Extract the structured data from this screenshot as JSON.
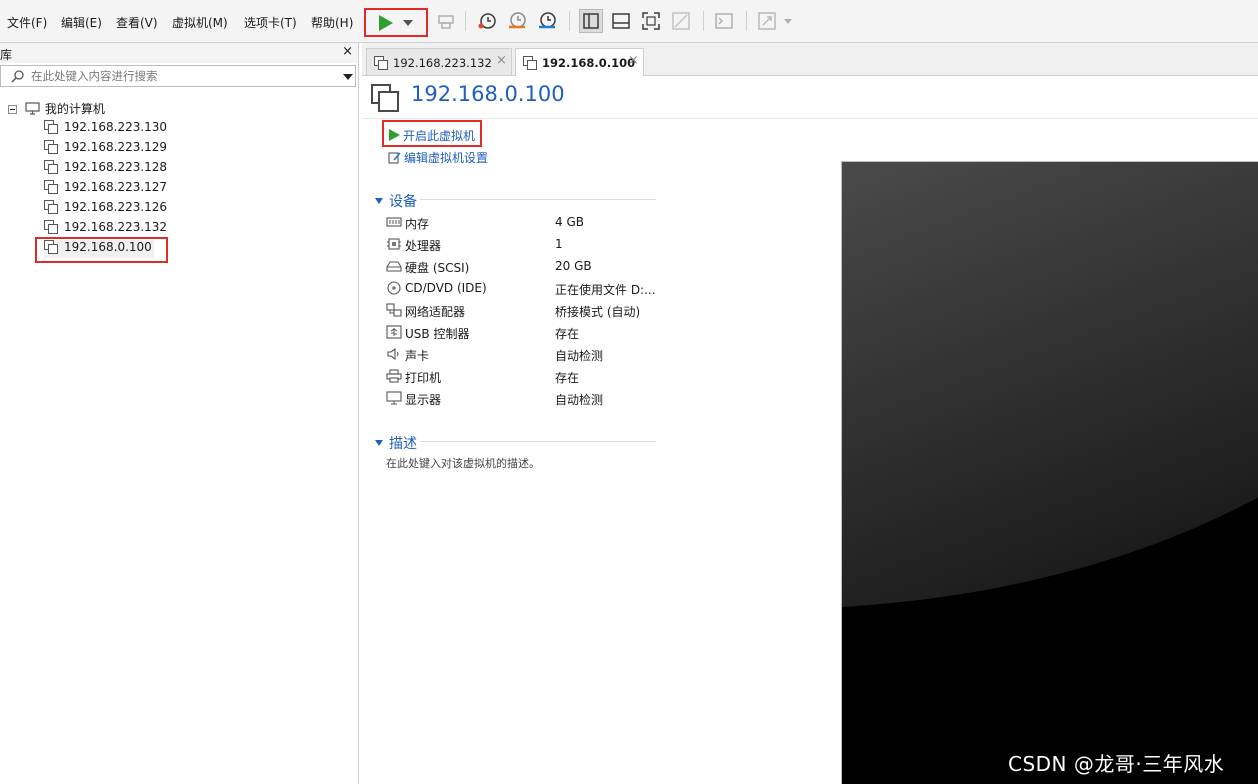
{
  "menu": [
    "文件(F)",
    "编辑(E)",
    "查看(V)",
    "虚拟机(M)",
    "选项卡(T)",
    "帮助(H)"
  ],
  "library": {
    "title": "库",
    "close": "×",
    "search_placeholder": "在此处键入内容进行搜索",
    "root_label": "我的计算机",
    "vms": [
      "192.168.223.130",
      "192.168.223.129",
      "192.168.223.128",
      "192.168.223.127",
      "192.168.223.126",
      "192.168.223.132",
      "192.168.0.100"
    ]
  },
  "tabs": [
    {
      "label": "192.168.223.132",
      "close": "×"
    },
    {
      "label": "192.168.0.100",
      "close": "×"
    }
  ],
  "vm": {
    "title": "192.168.0.100",
    "start_link": "开启此虚拟机",
    "edit_link": "编辑虚拟机设置",
    "devices_title": "设备",
    "devices": [
      {
        "name": "内存",
        "value": "4 GB",
        "icon": "memory-icon"
      },
      {
        "name": "处理器",
        "value": "1",
        "icon": "processor-icon"
      },
      {
        "name": "硬盘 (SCSI)",
        "value": "20 GB",
        "icon": "hard-disk-icon"
      },
      {
        "name": "CD/DVD (IDE)",
        "value": "正在使用文件 D:...",
        "icon": "cd-dvd-icon"
      },
      {
        "name": "网络适配器",
        "value": "桥接模式 (自动)",
        "icon": "network-adapter-icon"
      },
      {
        "name": "USB 控制器",
        "value": "存在",
        "icon": "usb-icon"
      },
      {
        "name": "声卡",
        "value": "自动检测",
        "icon": "sound-card-icon"
      },
      {
        "name": "打印机",
        "value": "存在",
        "icon": "printer-icon"
      },
      {
        "name": "显示器",
        "value": "自动检测",
        "icon": "display-icon"
      }
    ],
    "description_title": "描述",
    "description_placeholder": "在此处键入对该虚拟机的描述。"
  },
  "watermark": "CSDN @龙哥·三年风水",
  "colors": {
    "accent_blue": "#1f5fbf",
    "play_green": "#2e9e2e",
    "highlight_red": "#e02b2b"
  }
}
